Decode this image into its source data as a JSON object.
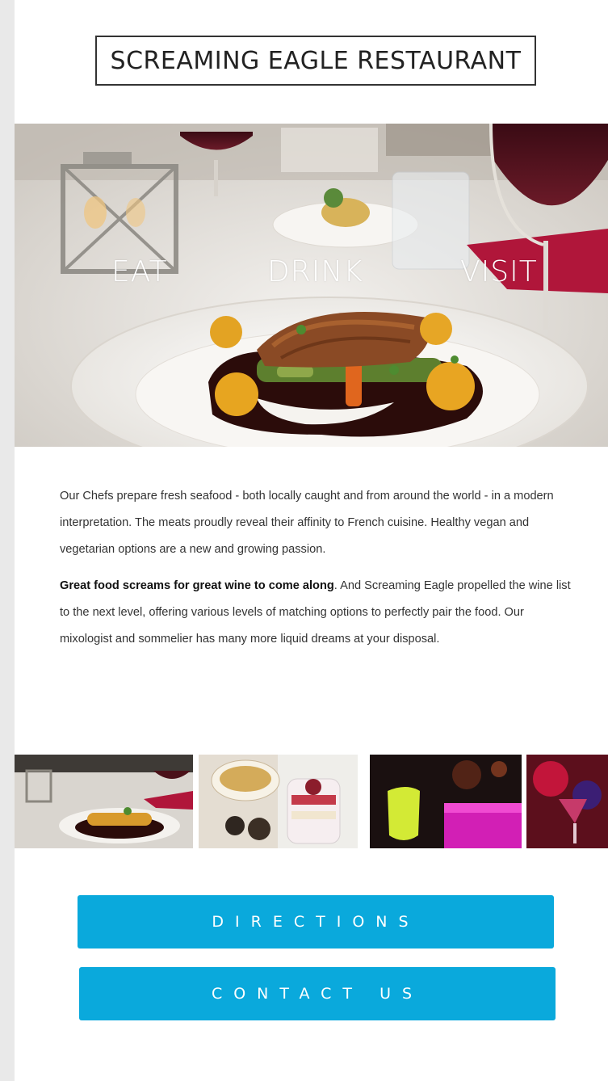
{
  "header": {
    "title": "SCREAMING EAGLE RESTAURANT"
  },
  "nav": {
    "items": [
      "EAT",
      "DRINK",
      "VISIT"
    ]
  },
  "content": {
    "paragraph1": "Our Chefs prepare fresh seafood - both locally caught and from around the world - in a modern interpretation. The meats proudly reveal their affinity to French cuisine. Healthy vegan and vegetarian options are a new and growing passion.",
    "paragraph2_bold": "Great food screams for great wine to come along",
    "paragraph2_rest": ". And Screaming Eagle propelled the wine list to the next level, offering various levels of matching options to perfectly pair the food. Our mixologist and sommelier has many more liquid dreams at your disposal."
  },
  "buttons": {
    "directions": "DIRECTIONS",
    "contact": "CONTACT US"
  },
  "colors": {
    "accent": "#0aa9dc",
    "text": "#333333",
    "wine": "#5a1420",
    "napkin": "#b0163a"
  }
}
